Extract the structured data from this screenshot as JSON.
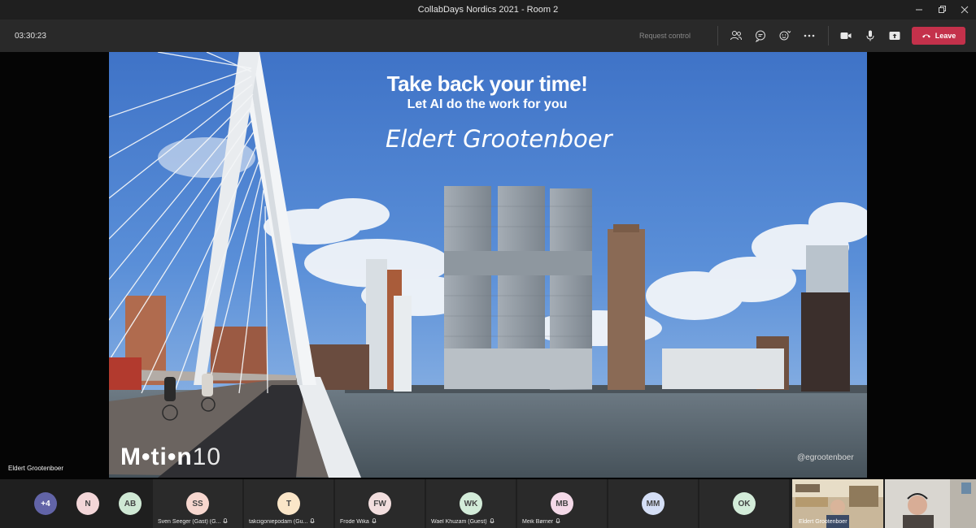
{
  "window": {
    "title": "CollabDays Nordics 2021 - Room 2",
    "controls": [
      "minimize-icon",
      "restore-icon",
      "close-icon"
    ]
  },
  "toolbar": {
    "timer": "03:30:23",
    "request_control": "Request control",
    "leave_label": "Leave",
    "icons": [
      "people-icon",
      "chat-icon",
      "reactions-icon",
      "more-icon",
      "camera-icon",
      "microphone-icon",
      "share-icon"
    ],
    "leave_color": "#c4314b"
  },
  "stage": {
    "presenter": "Eldert Grootenboer",
    "slide": {
      "title": "Take back your time!",
      "subtitle": "Let AI do the work for you",
      "speaker": "Eldert Grootenboer",
      "logo_main": "M•ti•n",
      "logo_num": "10",
      "handle": "@egrootenboer"
    }
  },
  "participants": {
    "overflow": {
      "label": "+4",
      "color": "#6264a7"
    },
    "small": [
      {
        "initials": "N",
        "color": "#f3d6d8"
      },
      {
        "initials": "AB",
        "color": "#cfe8d4"
      }
    ],
    "tiles": [
      {
        "initials": "SS",
        "name": "Sven Seeger (Gast) (G...",
        "color": "#f7d7cf"
      },
      {
        "initials": "T",
        "name": "takcigoniepodam (Gu...",
        "color": "#fbe6c8"
      },
      {
        "initials": "FW",
        "name": "Frode Wika",
        "color": "#f2dede"
      },
      {
        "initials": "WK",
        "name": "Wael Khuzam (Guest)",
        "color": "#d3ecd9"
      },
      {
        "initials": "MB",
        "name": "Meik Børner",
        "color": "#f4d9e8"
      },
      {
        "initials": "MM",
        "name": "",
        "color": "#d4def5"
      },
      {
        "initials": "OK",
        "name": "",
        "color": "#d3ecd9"
      }
    ],
    "video": [
      {
        "name": "Eldert Grootenboer"
      },
      {
        "name": ""
      }
    ]
  }
}
